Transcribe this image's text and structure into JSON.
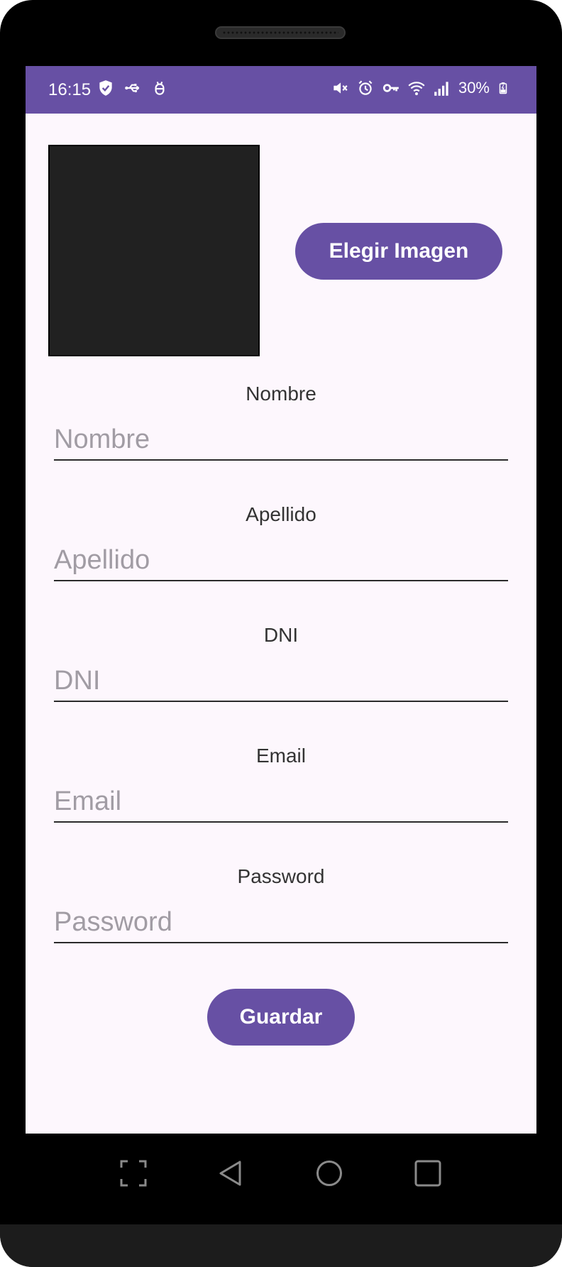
{
  "status_bar": {
    "time": "16:15",
    "battery_percent": "30%",
    "left_icons": [
      "shield-check-icon",
      "usb-icon",
      "android-debug-icon"
    ],
    "right_icons": [
      "vibrate-off-icon",
      "alarm-icon",
      "vpn-key-icon",
      "wifi-icon",
      "signal-icon",
      "battery-charging-icon"
    ],
    "color": "#6750a4"
  },
  "image_picker": {
    "button_label": "Elegir Imagen"
  },
  "form": {
    "fields": [
      {
        "label": "Nombre",
        "placeholder": "Nombre",
        "value": ""
      },
      {
        "label": "Apellido",
        "placeholder": "Apellido",
        "value": ""
      },
      {
        "label": "DNI",
        "placeholder": "DNI",
        "value": ""
      },
      {
        "label": "Email",
        "placeholder": "Email",
        "value": ""
      },
      {
        "label": "Password",
        "placeholder": "Password",
        "value": ""
      }
    ],
    "save_label": "Guardar"
  },
  "navigation_bar": {
    "buttons": [
      "screenshot-icon",
      "back-icon",
      "home-icon",
      "recents-icon"
    ]
  },
  "colors": {
    "accent": "#6750a4",
    "background": "#fdf7fd",
    "image_placeholder": "#212121"
  }
}
